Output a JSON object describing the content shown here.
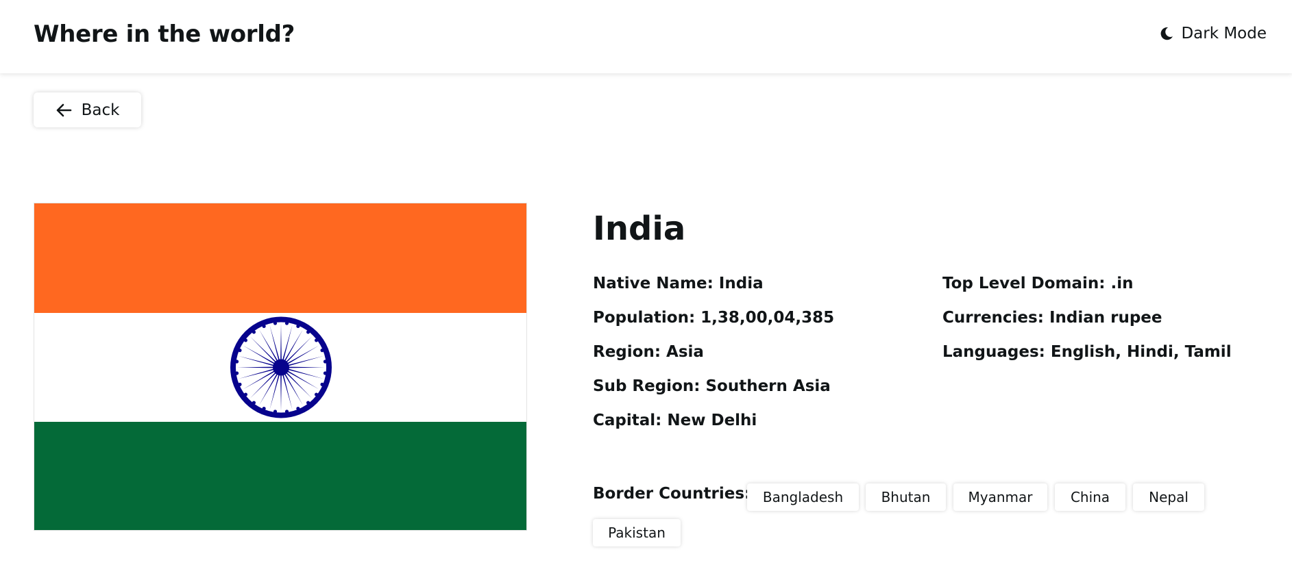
{
  "header": {
    "title": "Where in the world?",
    "dark_mode_label": "Dark Mode",
    "dark_mode_icon": "moon-icon"
  },
  "back_button": {
    "label": "Back",
    "icon": "arrow-left-icon"
  },
  "country": {
    "name": "India",
    "flag": {
      "colors": {
        "saffron": "#FF6820",
        "white": "#FFFFFF",
        "green": "#046A38",
        "chakra": "#07038D"
      },
      "chakra_spokes": 24
    },
    "details_left": [
      {
        "label": "Native Name:",
        "value": "India"
      },
      {
        "label": "Population:",
        "value": "1,38,00,04,385"
      },
      {
        "label": "Region:",
        "value": "Asia"
      },
      {
        "label": "Sub Region:",
        "value": "Southern Asia"
      },
      {
        "label": "Capital:",
        "value": "New Delhi"
      }
    ],
    "details_right": [
      {
        "label": "Top Level Domain:",
        "value": ".in"
      },
      {
        "label": "Currencies:",
        "value": "Indian rupee"
      },
      {
        "label": "Languages:",
        "value": "English, Hindi, Tamil"
      }
    ],
    "border_label": "Border Countries:",
    "border_countries": [
      "Bangladesh",
      "Bhutan",
      "Myanmar",
      "China",
      "Nepal",
      "Pakistan"
    ]
  }
}
